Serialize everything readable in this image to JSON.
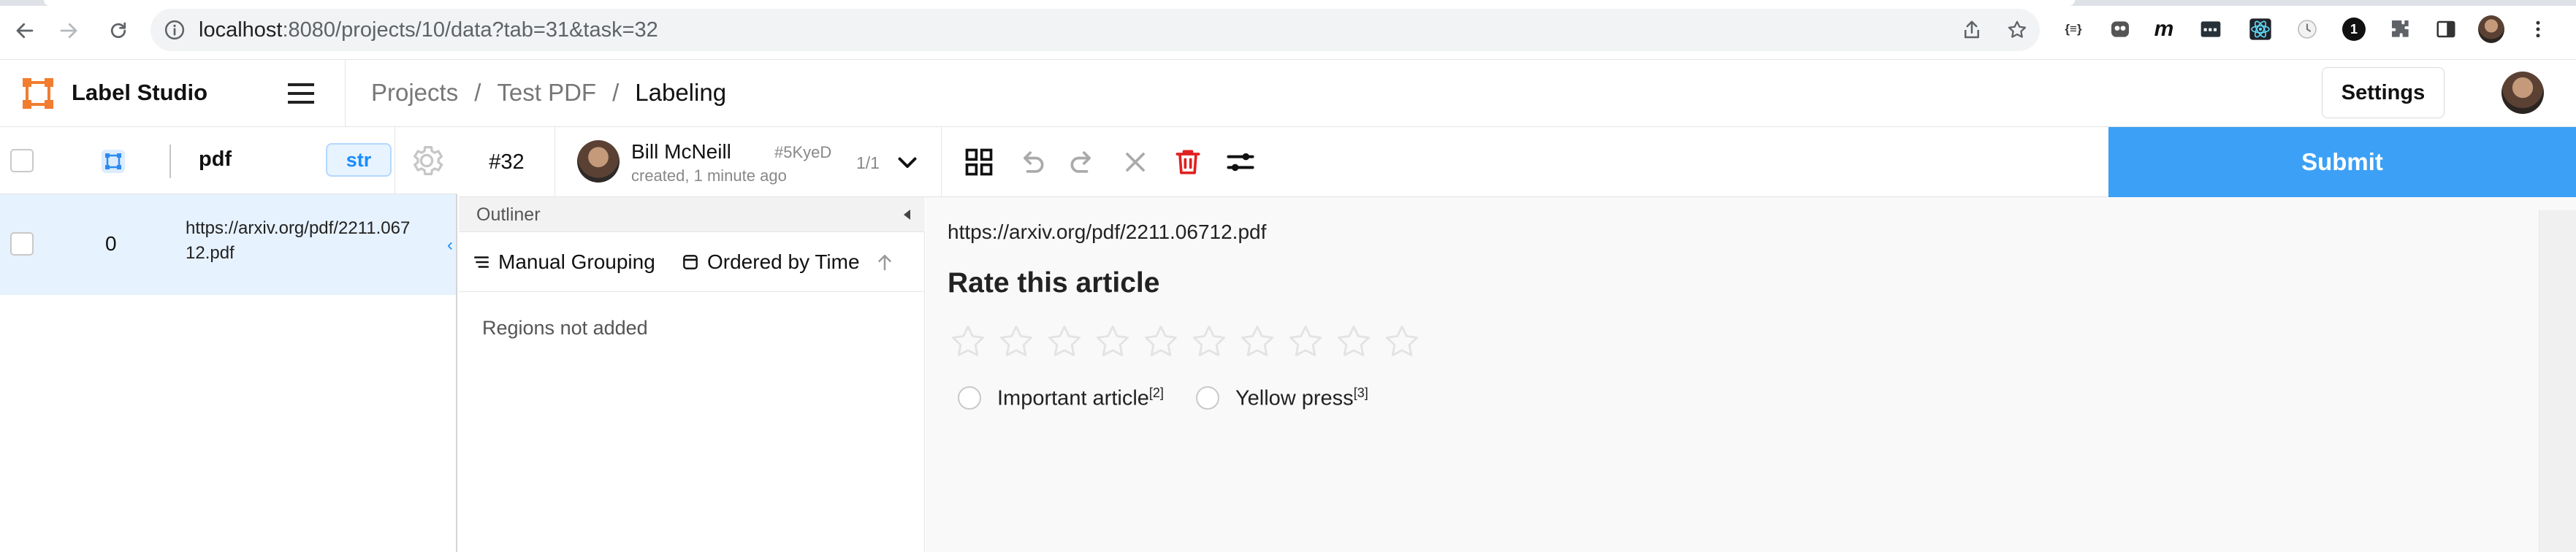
{
  "browser": {
    "url_host": "localhost",
    "url_rest": ":8080/projects/10/data?tab=31&task=32",
    "extensions": [
      "{≡}",
      "m",
      "1"
    ]
  },
  "app": {
    "brand": "Label Studio",
    "breadcrumb": {
      "projects": "Projects",
      "sep1": "/",
      "project": "Test PDF",
      "sep2": "/",
      "current": "Labeling"
    },
    "settings_label": "Settings"
  },
  "table": {
    "column_pdf": "pdf",
    "type_badge": "str",
    "rows": [
      {
        "id": "0",
        "pdf": "https://arxiv.org/pdf/2211.06712.pdf"
      }
    ]
  },
  "toolbar": {
    "task_id": "#32",
    "annotator_name": "Bill McNeill",
    "annotation_hash": "#5KyeD",
    "annotation_meta": "created, 1 minute ago",
    "annotation_count": "1/1",
    "submit_label": "Submit"
  },
  "outliner": {
    "title": "Outliner",
    "grouping_label": "Manual Grouping",
    "ordering_label": "Ordered by Time",
    "empty_text": "Regions not added"
  },
  "labeling": {
    "pdf_url": "https://arxiv.org/pdf/2211.06712.pdf",
    "rating_title": "Rate this article",
    "rating_max": 10,
    "rating_value": 0,
    "choices": [
      {
        "label": "Important article",
        "hotkey": "[2]"
      },
      {
        "label": "Yellow press",
        "hotkey": "[3]"
      }
    ]
  },
  "colors": {
    "accent": "#3ca0f6",
    "selected_row": "#e6f2fd",
    "delete": "#e02020"
  }
}
